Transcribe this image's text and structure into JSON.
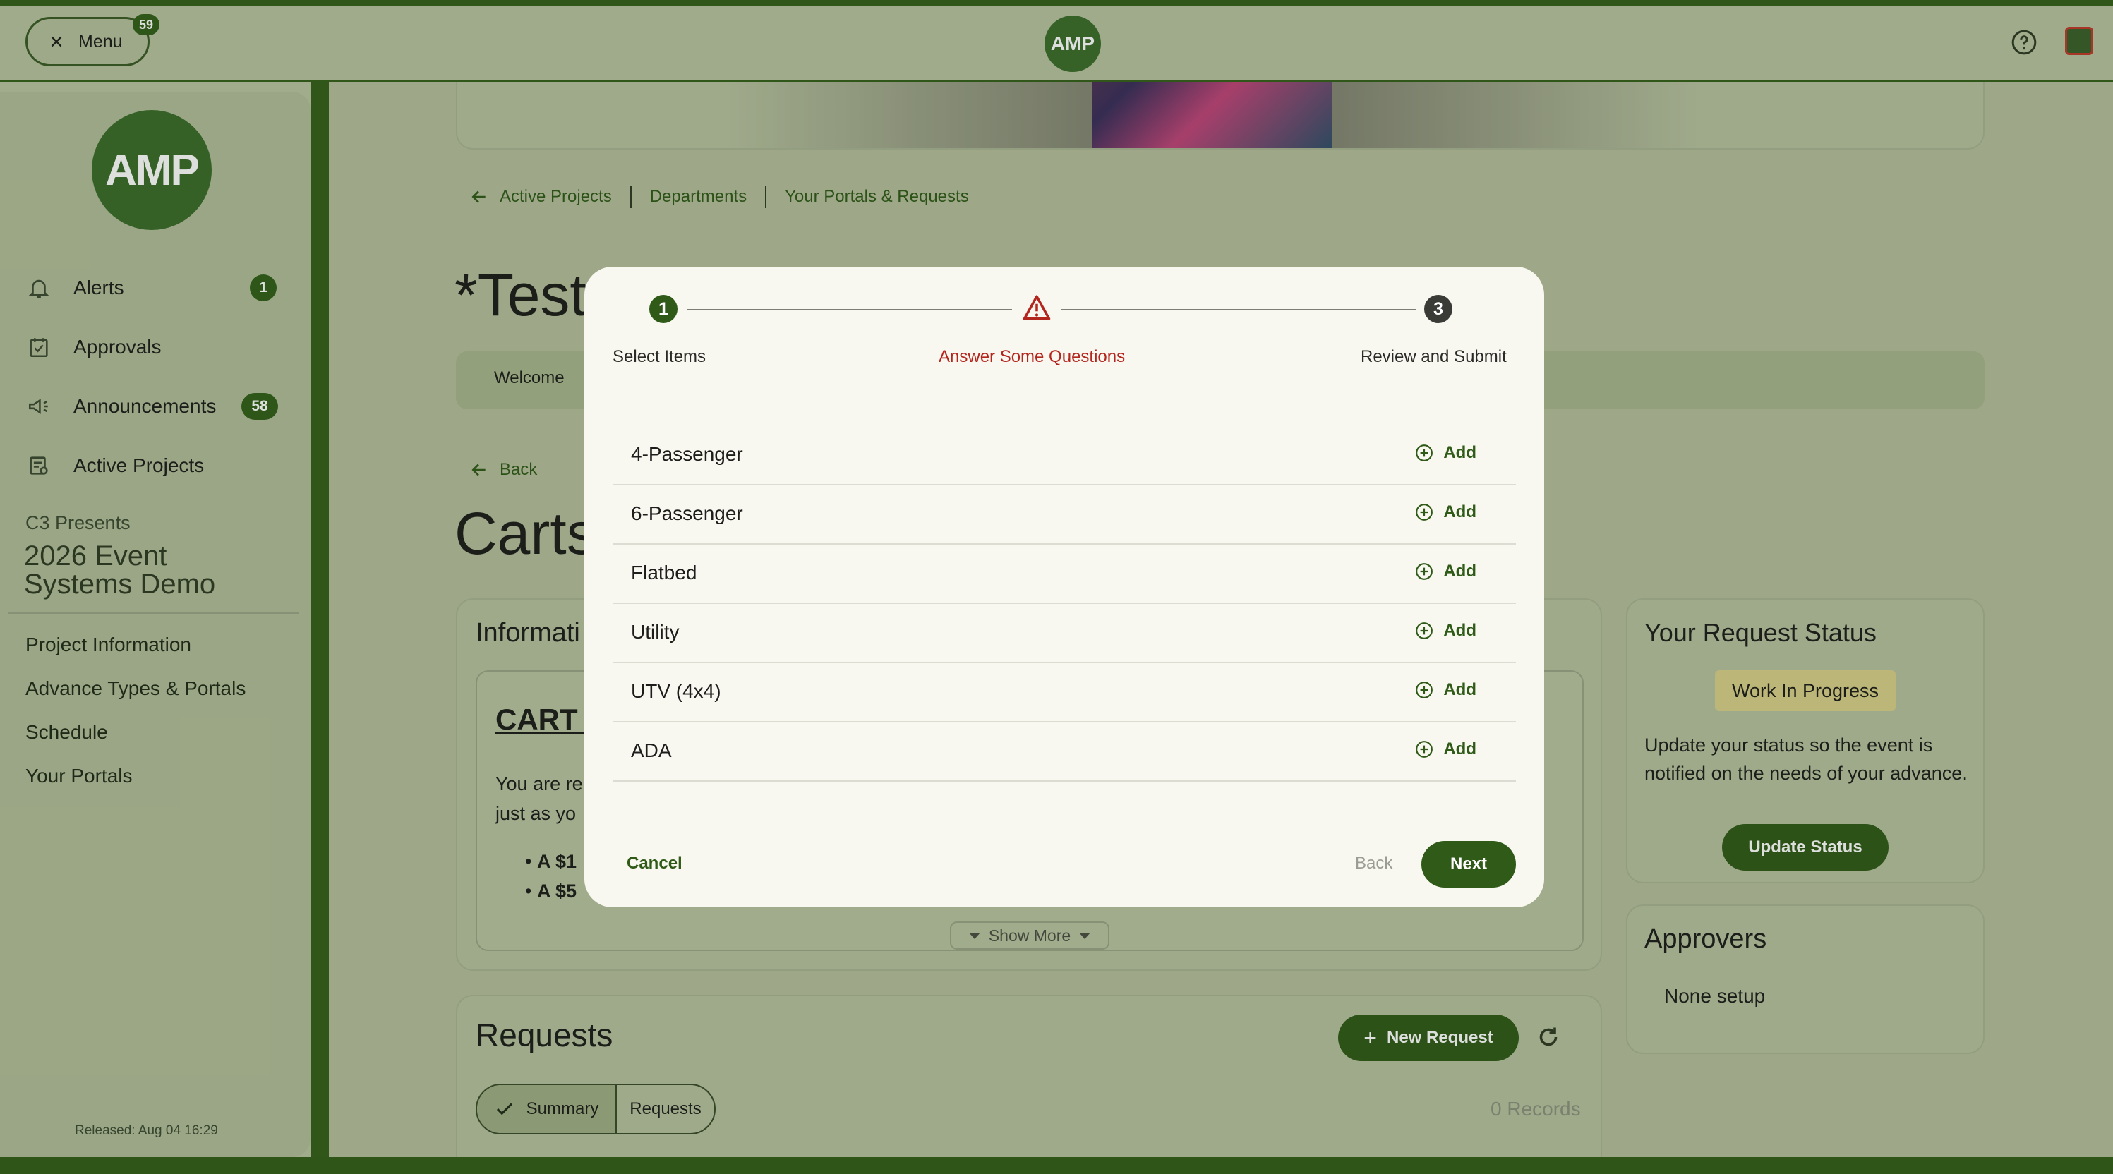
{
  "topbar": {
    "menu_label": "Menu",
    "menu_badge": "59",
    "logo_text": "AMP"
  },
  "sidebar": {
    "logo_text": "AMP",
    "nav": [
      {
        "label": "Alerts",
        "badge": "1",
        "icon": "bell-icon"
      },
      {
        "label": "Approvals",
        "badge": "",
        "icon": "calendar-check-icon"
      },
      {
        "label": "Announcements",
        "badge": "58",
        "icon": "megaphone-icon"
      },
      {
        "label": "Active Projects",
        "badge": "",
        "icon": "projects-icon"
      }
    ],
    "org": "C3 Presents",
    "project_title": "2026 Event Systems Demo",
    "links": [
      "Project Information",
      "Advance Types & Portals",
      "Schedule",
      "Your Portals"
    ],
    "released": "Released: Aug 04 16:29"
  },
  "background": {
    "breadcrumbs": [
      "Active Projects",
      "Departments",
      "Your Portals & Requests"
    ],
    "page_title": "*Test",
    "tab_welcome": "Welcome",
    "back": "Back",
    "section_title": "Carts",
    "info_title": "Informati",
    "cart_heading": "CART I",
    "info_text_1": "You are re",
    "info_text_2": "just as yo",
    "bullet_1": "A $1",
    "bullet_2": "A $5",
    "show_more": "Show More",
    "status": {
      "title": "Your Request Status",
      "badge": "Work In Progress",
      "text": "Update your status so the event is notified on the needs of your advance.",
      "button": "Update Status"
    },
    "approvers": {
      "title": "Approvers",
      "value": "None setup"
    },
    "requests": {
      "title": "Requests",
      "new_button": "New Request",
      "seg_summary": "Summary",
      "seg_requests": "Requests",
      "records": "0 Records"
    }
  },
  "modal": {
    "steps": [
      {
        "num": "1",
        "label": "Select Items"
      },
      {
        "num": "",
        "label": "Answer Some Questions"
      },
      {
        "num": "3",
        "label": "Review and Submit"
      }
    ],
    "items": [
      "4-Passenger",
      "6-Passenger",
      "Flatbed",
      "Utility",
      "UTV (4x4)",
      "ADA"
    ],
    "add_label": "Add",
    "cancel": "Cancel",
    "back": "Back",
    "next": "Next"
  },
  "colors": {
    "brand": "#2f5a18",
    "warning": "#b3261e",
    "badge_bg": "#d9cf8a"
  }
}
